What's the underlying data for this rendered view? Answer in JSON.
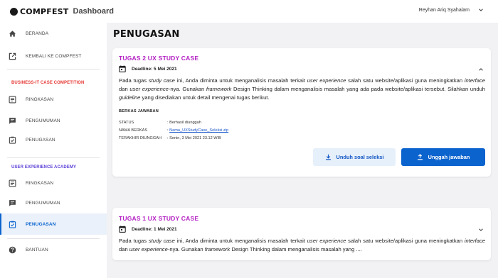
{
  "app": {
    "brand": "COMPFEST",
    "section": "Dashboard",
    "user_name": "Reyhan Ariq Syahalam"
  },
  "sidebar": {
    "items": [
      {
        "label": "BERANDA",
        "icon": "home-icon"
      },
      {
        "label": "KEMBALI KE COMPFEST",
        "icon": "external-link-icon"
      }
    ],
    "section_1": {
      "title": "BUSINESS-IT CASE COMPETITION",
      "color": "#e53935",
      "items": [
        {
          "label": "RINGKASAN",
          "icon": "summary-icon"
        },
        {
          "label": "PENGUMUMAN",
          "icon": "announcement-icon"
        },
        {
          "label": "PENUGASAN",
          "icon": "assignment-icon"
        }
      ]
    },
    "section_2": {
      "title": "USER EXPERIENCE ACADEMY",
      "color": "#5b3fd6",
      "items": [
        {
          "label": "RINGKASAN",
          "icon": "summary-icon"
        },
        {
          "label": "PENGUMUMAN",
          "icon": "announcement-icon"
        },
        {
          "label": "PENUGASAN",
          "icon": "assignment-icon",
          "active": true
        }
      ]
    },
    "help": {
      "label": "BANTUAN",
      "icon": "help-icon"
    }
  },
  "page": {
    "title": "PENUGASAN"
  },
  "tasks": [
    {
      "title": "TUGAS 2 UX STUDY CASE",
      "deadline": "Deadline: 5 Mei 2021",
      "expanded": true,
      "description": {
        "p1": "Pada tugas ",
        "i1": "study case",
        "p2": " ini, Anda diminta untuk menganalisis masalah terkait ",
        "i2": "user experience",
        "p3": " salah satu website/aplikasi guna meningkatkan ",
        "i3": "interface",
        "p4": " dan ",
        "i4": "user experience",
        "p5": "-nya. Gunakan ",
        "i5": "framework",
        "p6": " Design Thinking dalam menganalisis masalah yang ada pada website/aplikasi tersebut. Silahkan unduh ",
        "i6": "guideline",
        "p7": " yang disediakan untuk detail mengenai tugas berikut."
      },
      "submission": {
        "heading": "BERKAS JAWABAN",
        "rows": [
          {
            "key": "STATUS",
            "value": ": Berhasil diunggah"
          },
          {
            "key": "NAMA BERKAS",
            "sep": ": ",
            "link": "Nama_UXStudyCase_Seleksi.zip"
          },
          {
            "key": "TERAKHIR DIUNGGAH",
            "value": ": Senin, 3 Mei 2021 23.12 WIB"
          }
        ]
      },
      "buttons": {
        "download": "Unduh soal seleksi",
        "upload": "Unggah jawaban"
      }
    },
    {
      "title": "TUGAS 1 UX STUDY CASE",
      "deadline": "Deadline: 1 Mei 2021",
      "expanded": false,
      "description": {
        "p1": "Pada tugas ",
        "i1": "study case",
        "p2": " ini, Anda diminta untuk menganalisis masalah terkait ",
        "i2": "user experience",
        "p3": " salah satu website/aplikasi guna meningkatkan ",
        "i3": "interface",
        "p4": " dan ",
        "i4": "user experience",
        "p5": "-nya. Gunakan ",
        "i5": "framework",
        "p6": " Design Thinking dalam menganalisis masalah yang ...."
      }
    }
  ],
  "colors": {
    "accent": "#0b63ce",
    "task_title": "#b321c3",
    "background": "#f2f2f5"
  }
}
